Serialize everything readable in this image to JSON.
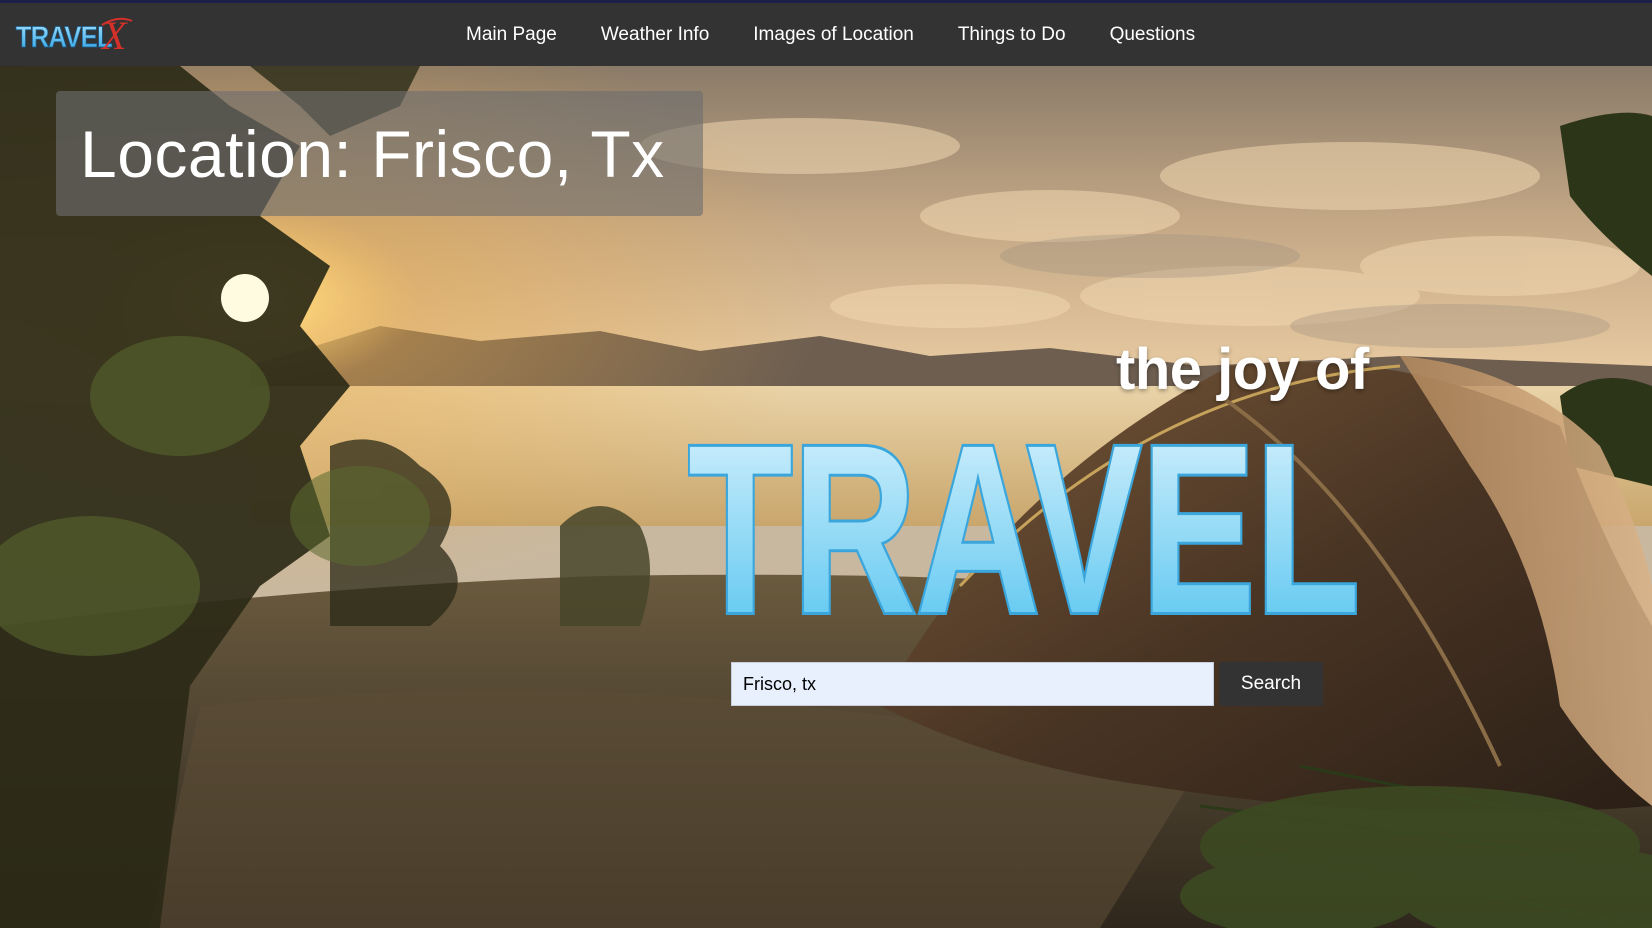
{
  "brand": {
    "logo_text": "TRAVEL",
    "logo_mark": "X"
  },
  "nav": {
    "items": [
      {
        "label": "Main Page"
      },
      {
        "label": "Weather Info"
      },
      {
        "label": "Images of Location"
      },
      {
        "label": "Things to Do"
      },
      {
        "label": "Questions"
      }
    ]
  },
  "hero": {
    "location_label": "Location: Frisco, Tx",
    "tagline": "the joy of",
    "headline": "TRAVEL",
    "background_image": "sunset-campsite-photo"
  },
  "search": {
    "value": "Frisco, tx",
    "button_label": "Search"
  },
  "colors": {
    "nav_bg": "#333333",
    "headline_light": "#dff4fd",
    "headline_dark": "#4fc2ef",
    "input_bg": "#e8f0fe"
  }
}
